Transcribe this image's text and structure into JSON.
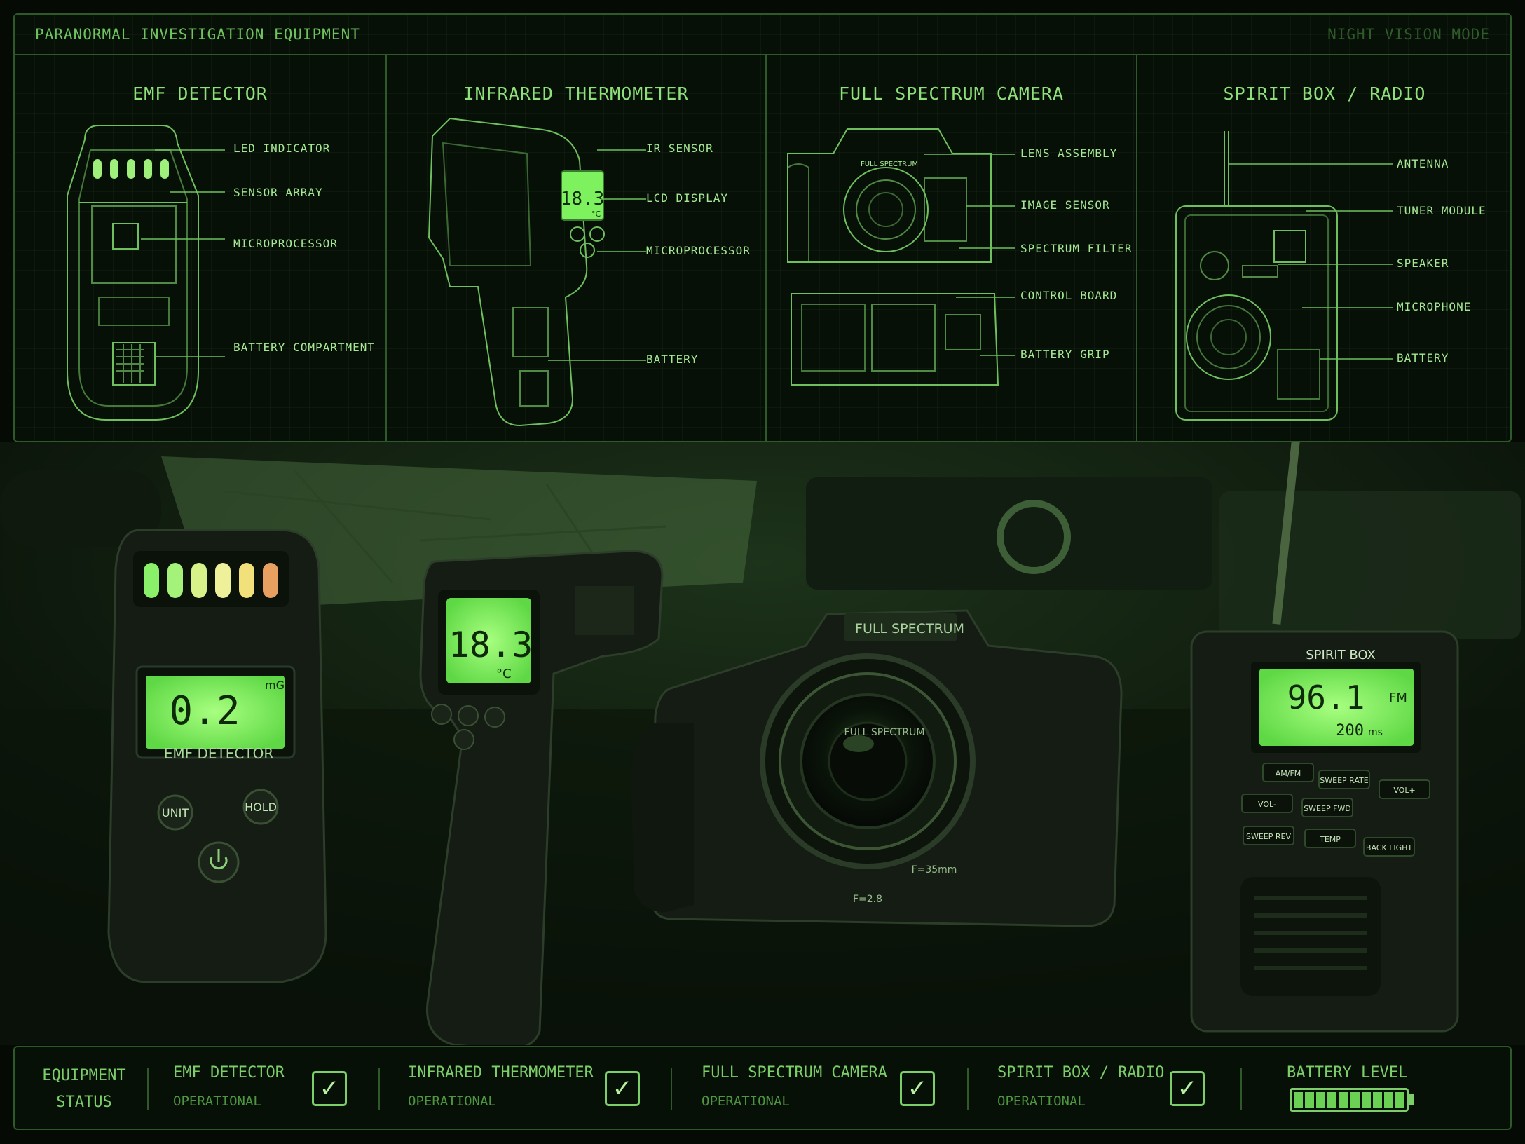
{
  "header": {
    "title": "PARANORMAL INVESTIGATION EQUIPMENT",
    "mode": "NIGHT VISION MODE"
  },
  "blueprints": [
    {
      "title": "EMF DETECTOR",
      "callouts": [
        "LED INDICATOR",
        "SENSOR ARRAY",
        "MICROPROCESSOR",
        "BATTERY COMPARTMENT"
      ]
    },
    {
      "title": "INFRARED THERMOMETER",
      "callouts": [
        "IR SENSOR",
        "LCD DISPLAY",
        "MICROPROCESSOR",
        "BATTERY"
      ],
      "screen_value": "18.3",
      "screen_unit": "°C"
    },
    {
      "title": "FULL SPECTRUM CAMERA",
      "callouts": [
        "LENS ASSEMBLY",
        "IMAGE SENSOR",
        "SPECTRUM FILTER",
        "CONTROL BOARD",
        "BATTERY GRIP"
      ],
      "body_label": "FULL SPECTRUM"
    },
    {
      "title": "SPIRIT BOX / RADIO",
      "callouts": [
        "ANTENNA",
        "TUNER MODULE",
        "SPEAKER",
        "MICROPHONE",
        "BATTERY"
      ]
    }
  ],
  "devices": {
    "emf": {
      "reading": "0.2",
      "unit": "mG",
      "label": "EMF DETECTOR",
      "unit_button": "UNIT",
      "hold_button": "HOLD",
      "led_colors": [
        "#8af06a",
        "#a4f27a",
        "#d8f28a",
        "#eef09a",
        "#f2e07a",
        "#e8a060"
      ]
    },
    "thermometer": {
      "reading": "18.3",
      "unit": "°C"
    },
    "camera": {
      "top_label": "FULL SPECTRUM",
      "lens_label": "FULL SPECTRUM",
      "aperture": "F=2.8",
      "focal": "F=35mm"
    },
    "spirit_box": {
      "label": "SPIRIT BOX",
      "frequency": "96.1",
      "band": "FM",
      "sweep": "200",
      "sweep_unit": "ms",
      "buttons": [
        "AM/FM",
        "SWEEP RATE",
        "VOL+",
        "VOL-",
        "SWEEP FWD",
        "SWEEP REV",
        "TEMP",
        "BACK LIGHT"
      ]
    }
  },
  "status_bar": {
    "title_line1": "EQUIPMENT",
    "title_line2": "STATUS",
    "items": [
      {
        "name": "EMF DETECTOR",
        "state": "OPERATIONAL"
      },
      {
        "name": "INFRARED THERMOMETER",
        "state": "OPERATIONAL"
      },
      {
        "name": "FULL SPECTRUM CAMERA",
        "state": "OPERATIONAL"
      },
      {
        "name": "SPIRIT BOX / RADIO",
        "state": "OPERATIONAL"
      }
    ],
    "battery_label": "BATTERY LEVEL",
    "battery_level": 1.0
  },
  "colors": {
    "accent": "#7cd46a",
    "border": "#2e5a2a",
    "lcd": "#7ef25e"
  }
}
